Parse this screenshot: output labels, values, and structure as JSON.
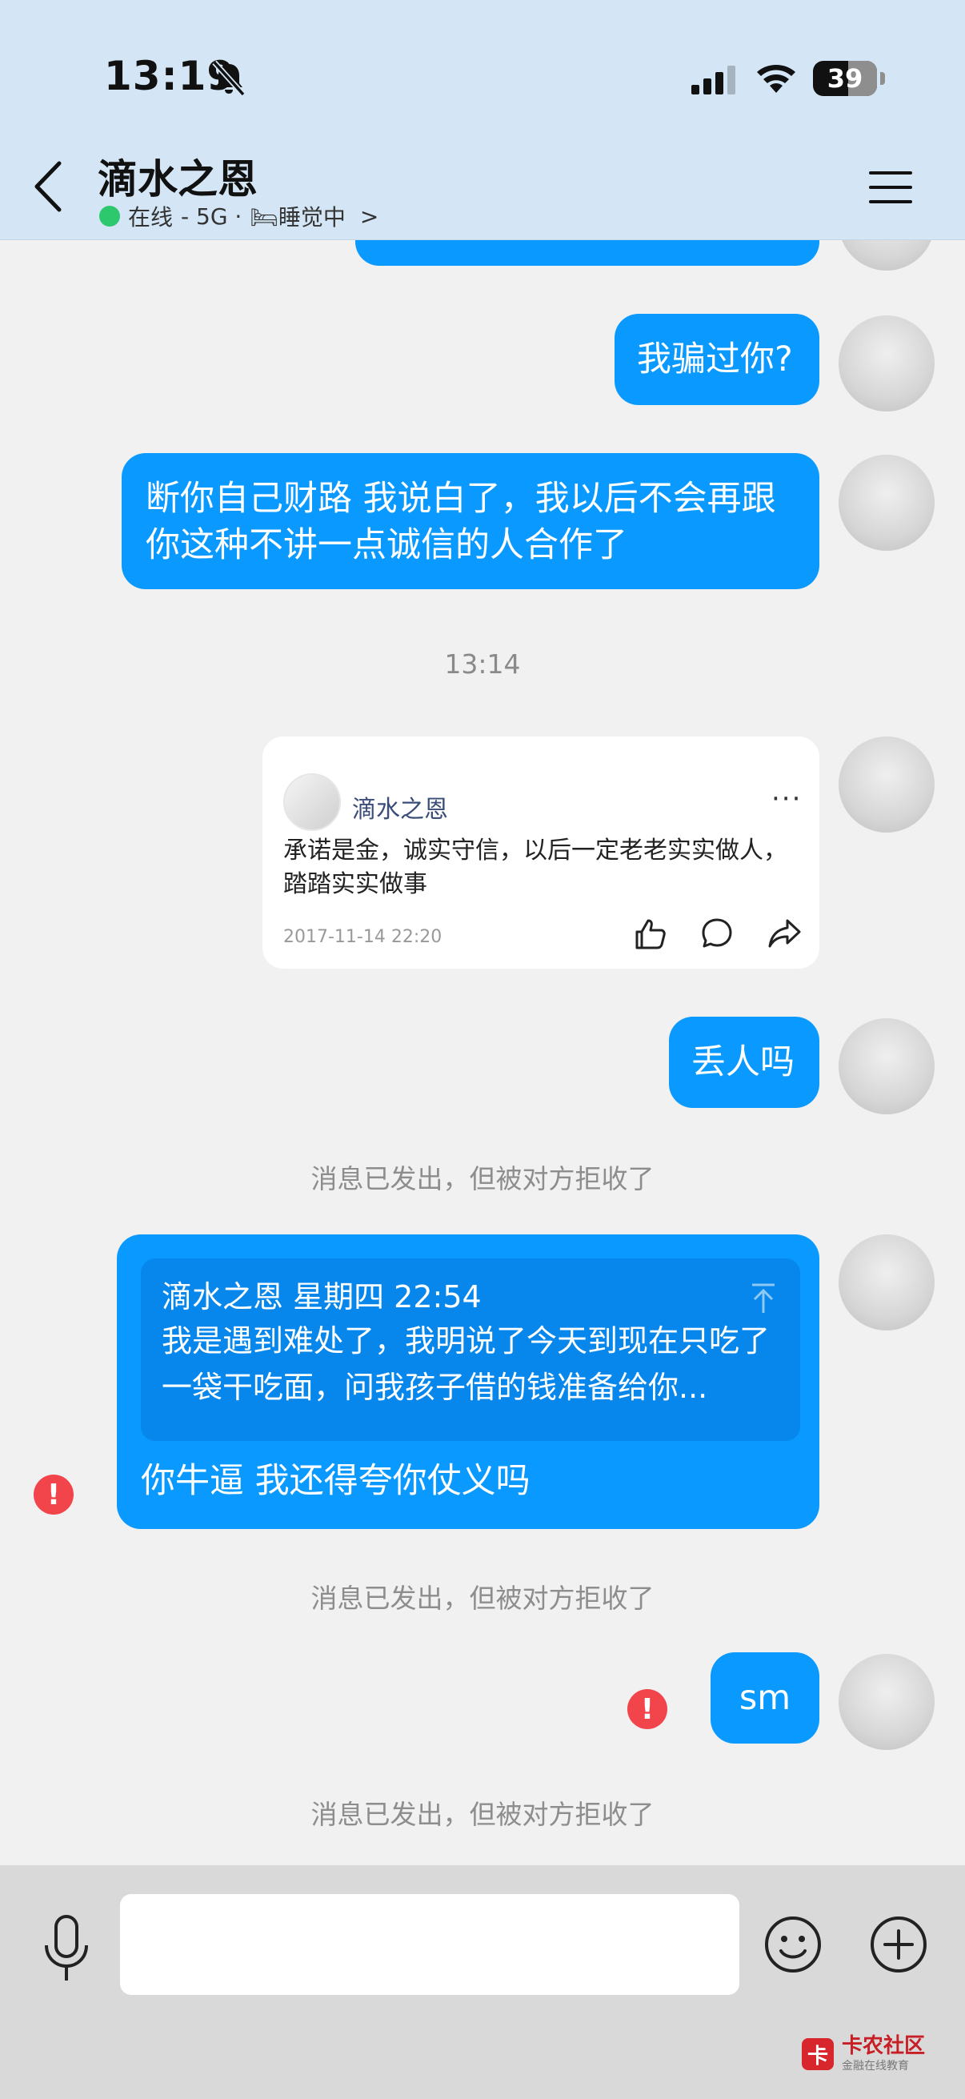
{
  "status_bar": {
    "time": "13:19",
    "battery": "39"
  },
  "header": {
    "contact_name": "滴水之恩",
    "presence_online": "在线",
    "presence_network": "- 5G ·",
    "presence_status": "🛏睡觉中",
    "chevron": ">"
  },
  "messages": [
    {
      "type": "text",
      "text": "我骗过你?"
    },
    {
      "type": "text",
      "text": "断你自己财路 我说白了，我以后不会再跟你这种不讲一点诚信的人合作了"
    },
    {
      "type": "time",
      "text": "13:14"
    },
    {
      "type": "share_card",
      "user": "滴水之恩",
      "more": "···",
      "content": "承诺是金，诚实守信，以后一定老老实实做人，踏踏实实做事",
      "date": "2017-11-14 22:20"
    },
    {
      "type": "text",
      "text": "丢人吗"
    },
    {
      "type": "system",
      "text": "消息已发出，但被对方拒收了"
    },
    {
      "type": "reply",
      "quote_header": "滴水之恩  星期四 22:54",
      "quote_body": "我是遇到难处了，我明说了今天到现在只吃了一袋干吃面，问我孩子借的钱准备给你...",
      "text": "你牛逼 我还得夸你仗义吗",
      "error": "!"
    },
    {
      "type": "system",
      "text": "消息已发出，但被对方拒收了"
    },
    {
      "type": "text",
      "text": "sm",
      "error": "!"
    },
    {
      "type": "system",
      "text": "消息已发出，但被对方拒收了"
    }
  ],
  "input_bar": {
    "placeholder": ""
  },
  "watermark": {
    "logo_char": "卡",
    "title": "卡农社区",
    "subtitle": "金融在线教育"
  },
  "colors": {
    "header_bg": "#d4e6f5",
    "bubble": "#0a99ff",
    "quote_bg": "#0787ec",
    "error": "#f2444b",
    "online": "#2dc76d",
    "chat_bg": "#f1f1f1"
  }
}
